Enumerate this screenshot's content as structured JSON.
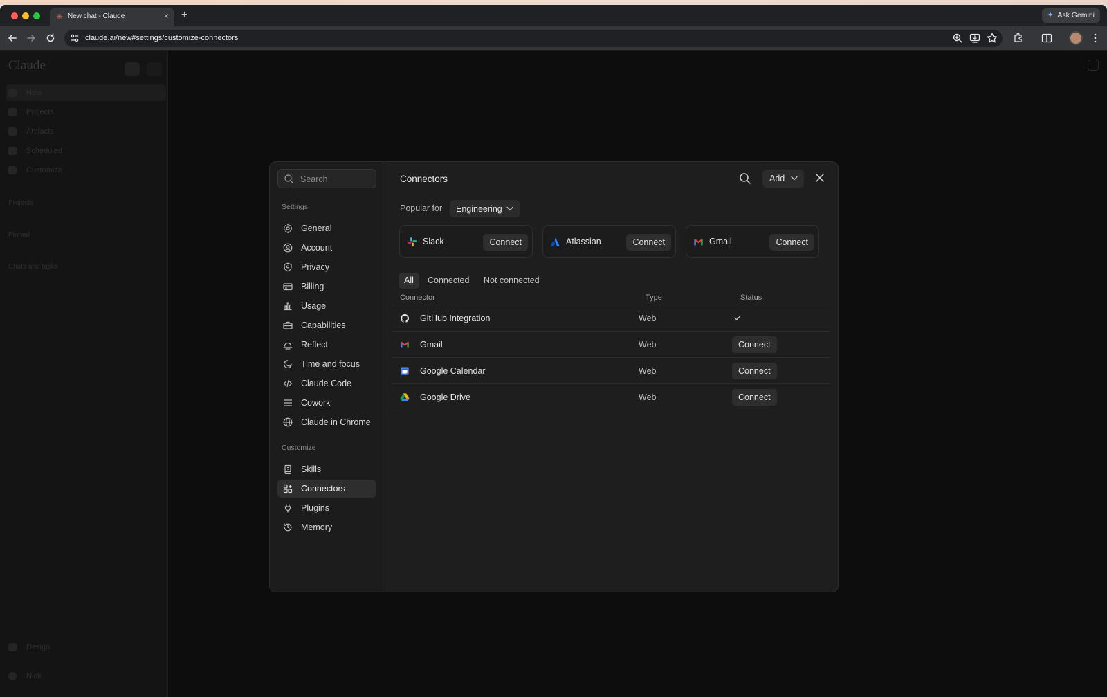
{
  "browser": {
    "tab_title": "New chat - Claude",
    "url": "claude.ai/new#settings/customize-connectors",
    "ask_gemini": "Ask Gemini"
  },
  "sidebar_bg": {
    "logo": "Claude",
    "items": [
      "New",
      "Projects",
      "Artifacts",
      "Scheduled",
      "Customize"
    ],
    "sections": [
      "Projects",
      "Pinned",
      "Chats and tasks"
    ],
    "bottom": [
      "Design",
      "Nick"
    ]
  },
  "modal": {
    "search_placeholder": "Search",
    "settings_heading": "Settings",
    "settings_items": [
      "General",
      "Account",
      "Privacy",
      "Billing",
      "Usage",
      "Capabilities",
      "Reflect",
      "Time and focus",
      "Claude Code",
      "Cowork",
      "Claude in Chrome"
    ],
    "customize_heading": "Customize",
    "customize_items": [
      "Skills",
      "Connectors",
      "Plugins",
      "Memory"
    ],
    "title": "Connectors",
    "add_label": "Add",
    "popular_label": "Popular for",
    "popular_selected": "Engineering",
    "popular_cards": [
      {
        "name": "Slack",
        "button": "Connect",
        "icon": "slack-logo"
      },
      {
        "name": "Atlassian",
        "button": "Connect",
        "icon": "atlassian-logo"
      },
      {
        "name": "Gmail",
        "button": "Connect",
        "icon": "gmail-logo"
      }
    ],
    "filter_tabs": [
      "All",
      "Connected",
      "Not connected"
    ],
    "active_filter": "All",
    "columns": [
      "Connector",
      "Type",
      "Status"
    ],
    "rows": [
      {
        "name": "GitHub Integration",
        "type": "Web",
        "status": "connected",
        "icon": "github-logo"
      },
      {
        "name": "Gmail",
        "type": "Web",
        "status": "Connect",
        "icon": "gmail-logo"
      },
      {
        "name": "Google Calendar",
        "type": "Web",
        "status": "Connect",
        "icon": "google-calendar-logo"
      },
      {
        "name": "Google Drive",
        "type": "Web",
        "status": "Connect",
        "icon": "google-drive-logo"
      }
    ]
  },
  "colors": {
    "modal_bg": "#1e1e1e",
    "accent": "#d97757"
  }
}
